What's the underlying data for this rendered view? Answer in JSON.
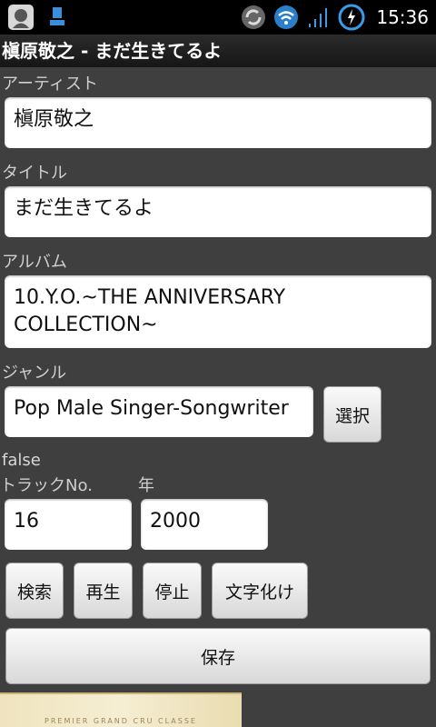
{
  "status_bar": {
    "time": "15:36",
    "icons": [
      "app-avatar-icon",
      "usb-debug-icon",
      "sync-icon",
      "wifi-icon",
      "signal-icon",
      "charging-battery-icon"
    ]
  },
  "title": "槇原敬之 - まだ生きてるよ",
  "form": {
    "artist_label": "アーティスト",
    "artist_value": "槇原敬之",
    "title_label": "タイトル",
    "title_value": "まだ生きてるよ",
    "album_label": "アルバム",
    "album_value": "10.Y.O.~THE ANNIVERSARY COLLECTION~",
    "genre_label": "ジャンル",
    "genre_value": "Pop Male Singer-Songwriter",
    "select_button": "選択",
    "flag_text": "false",
    "track_label": "トラックNo.",
    "track_value": "16",
    "year_label": "年",
    "year_value": "2000"
  },
  "actions": {
    "search": "検索",
    "play": "再生",
    "stop": "停止",
    "mojibake": "文字化け",
    "save": "保存"
  },
  "ad": {
    "text": "PREMIER GRAND CRU CLASSE"
  }
}
